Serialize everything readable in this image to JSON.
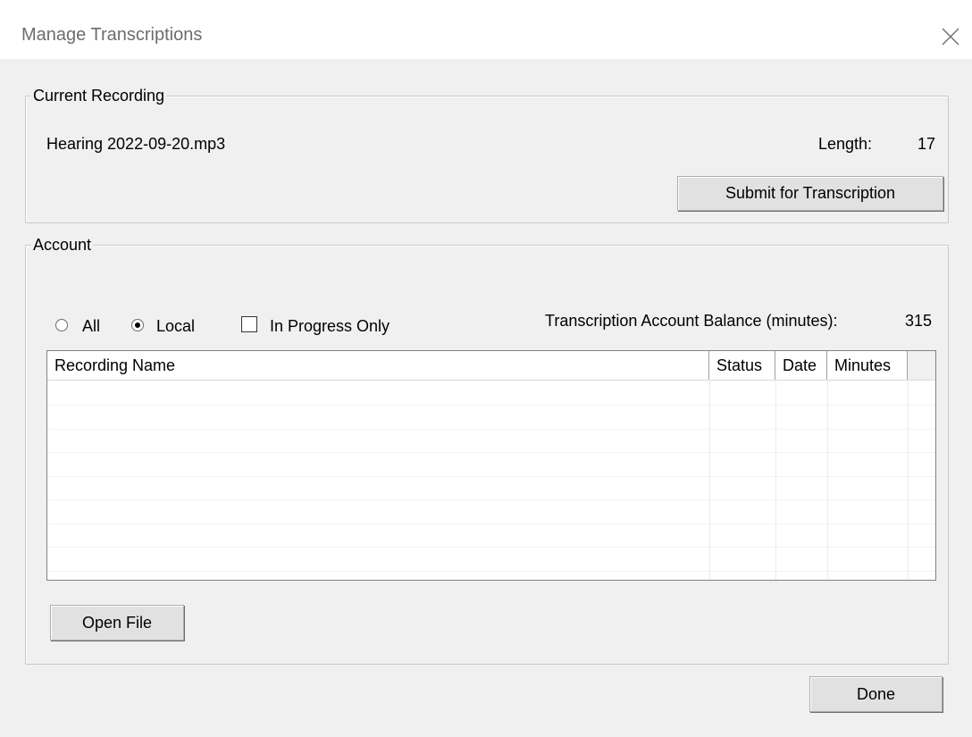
{
  "window": {
    "title": "Manage Transcriptions"
  },
  "current_recording": {
    "legend": "Current Recording",
    "file_name": "Hearing 2022-09-20.mp3",
    "length_label": "Length:",
    "length_value": "17",
    "submit_label": "Submit for Transcription"
  },
  "account": {
    "legend": "Account",
    "filters": {
      "all_label": "All",
      "local_label": "Local",
      "selected": "Local",
      "in_progress_label": "In Progress Only",
      "in_progress_checked": false
    },
    "balance_label": "Transcription Account Balance (minutes):",
    "balance_value": "315",
    "table": {
      "columns": [
        "Recording Name",
        "Status",
        "Date",
        "Minutes"
      ],
      "rows": []
    },
    "open_file_label": "Open File"
  },
  "footer": {
    "done_label": "Done"
  },
  "icons": {
    "close": "close-icon"
  }
}
